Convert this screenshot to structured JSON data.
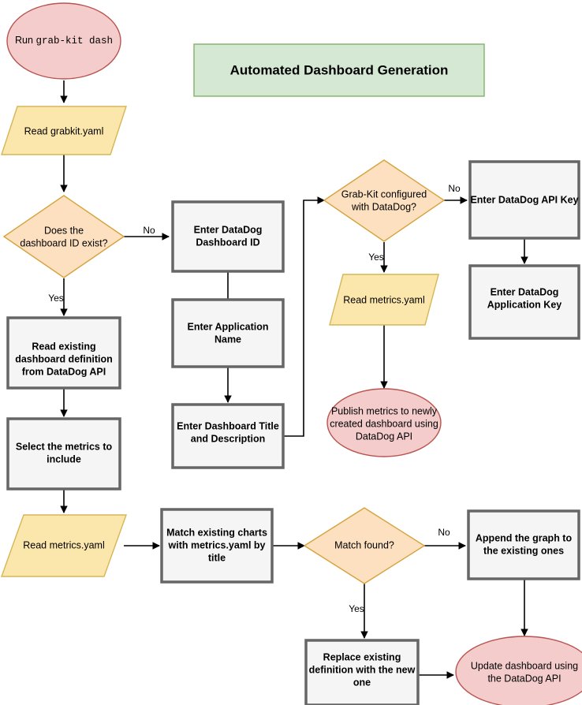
{
  "diagram": {
    "title": "Automated Dashboard Generation",
    "colors": {
      "process_fill": "#f5f5f5",
      "process_stroke": "#666666",
      "decision_fill": "#fce0c0",
      "decision_stroke": "#d6a33c",
      "io_fill": "#fbe6ac",
      "io_stroke": "#d6b656",
      "terminator_fill": "#f4cccc",
      "terminator_stroke": "#b85450",
      "title_fill": "#d5e8d4",
      "title_stroke": "#82b366",
      "connector": "#000000"
    },
    "nodes": {
      "start": {
        "label_prefix": "Run ",
        "label_code": "grab-kit dash",
        "shape": "ellipse"
      },
      "read_grabkit": {
        "label": "Read grabkit.yaml",
        "shape": "parallelogram"
      },
      "dashboard_id_exists": {
        "line1": "Does the",
        "line2": "dashboard ID exist?",
        "shape": "diamond"
      },
      "read_existing_def": {
        "line1": "Read existing",
        "line2": "dashboard definition",
        "line3": "from DataDog API",
        "shape": "process"
      },
      "select_metrics": {
        "line1": "Select the metrics to",
        "line2": "include",
        "shape": "process"
      },
      "read_metrics_left": {
        "label": "Read metrics.yaml",
        "shape": "parallelogram"
      },
      "match_charts": {
        "line1": "Match existing charts",
        "line2": "with metrics.yaml by",
        "line3": "title",
        "shape": "process"
      },
      "match_found": {
        "label": "Match found?",
        "shape": "diamond"
      },
      "append_graph": {
        "line1": "Append the graph to",
        "line2": "the existing ones",
        "shape": "process"
      },
      "replace_def": {
        "line1": "Replace existing",
        "line2": "definition with the new",
        "line3": "one",
        "shape": "process"
      },
      "update_dashboard": {
        "line1": "Update dashboard using",
        "line2": "the DataDog API",
        "shape": "ellipse"
      },
      "enter_dashboard_id": {
        "line1": "Enter DataDog",
        "line2": "Dashboard ID",
        "shape": "process"
      },
      "enter_app_name": {
        "line1": "Enter Application",
        "line2": "Name",
        "shape": "process"
      },
      "enter_title_desc": {
        "line1": "Enter Dashboard Title",
        "line2": "and Description",
        "shape": "process"
      },
      "grabkit_configured": {
        "line1": "Grab-Kit configured",
        "line2": "with DataDog?",
        "shape": "diamond"
      },
      "enter_api_key": {
        "label": "Enter DataDog API Key",
        "shape": "process"
      },
      "enter_app_key": {
        "line1": "Enter DataDog",
        "line2": "Application Key",
        "shape": "process"
      },
      "read_metrics_mid": {
        "label": "Read metrics.yaml",
        "shape": "parallelogram"
      },
      "publish_metrics": {
        "line1": "Publish metrics to newly",
        "line2": "created dashboard using",
        "line3": "DataDog API",
        "shape": "ellipse"
      }
    },
    "edge_labels": {
      "dashboard_id_no": "No",
      "dashboard_id_yes": "Yes",
      "grabkit_no": "No",
      "grabkit_yes": "Yes",
      "match_no": "No",
      "match_yes": "Yes"
    }
  }
}
